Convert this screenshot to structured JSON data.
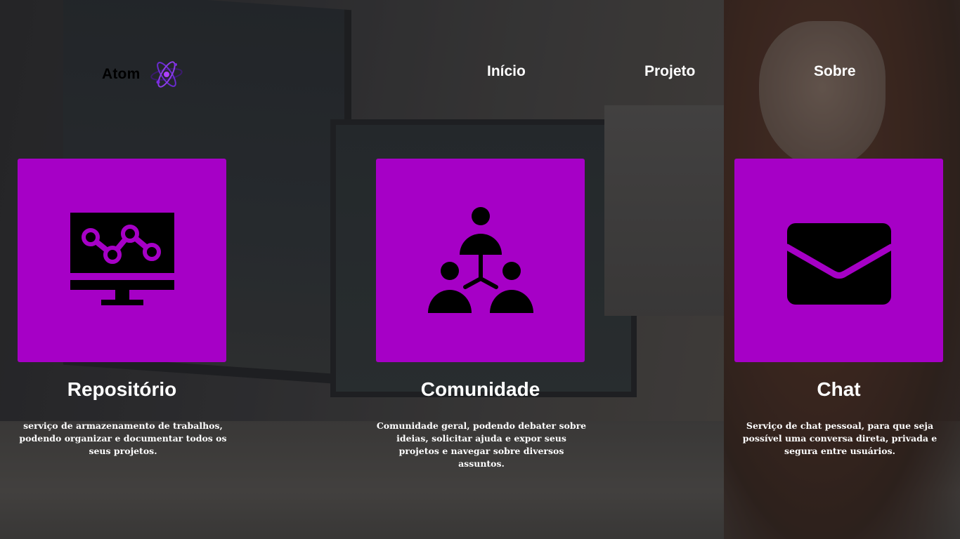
{
  "brand": {
    "name": "Atom",
    "logo_icon": "atom-icon"
  },
  "nav": {
    "items": [
      {
        "label": "Início"
      },
      {
        "label": "Projeto"
      },
      {
        "label": "Sobre"
      }
    ]
  },
  "cards": [
    {
      "icon": "monitor-chart-icon",
      "title": "Repositório",
      "description": "serviço de armazenamento de trabalhos, podendo organizar e documentar todos os seus projetos."
    },
    {
      "icon": "community-people-icon",
      "title": "Comunidade",
      "description": "Comunidade geral, podendo debater sobre ideias, solicitar ajuda e expor seus projetos e navegar sobre diversos assuntos."
    },
    {
      "icon": "envelope-icon",
      "title": "Chat",
      "description": "Serviço de chat pessoal, para que seja possível uma conversa direta, privada e segura entre usuários."
    }
  ],
  "colors": {
    "accent": "#a600c6",
    "text": "#ffffff",
    "brand_text": "#000000"
  }
}
